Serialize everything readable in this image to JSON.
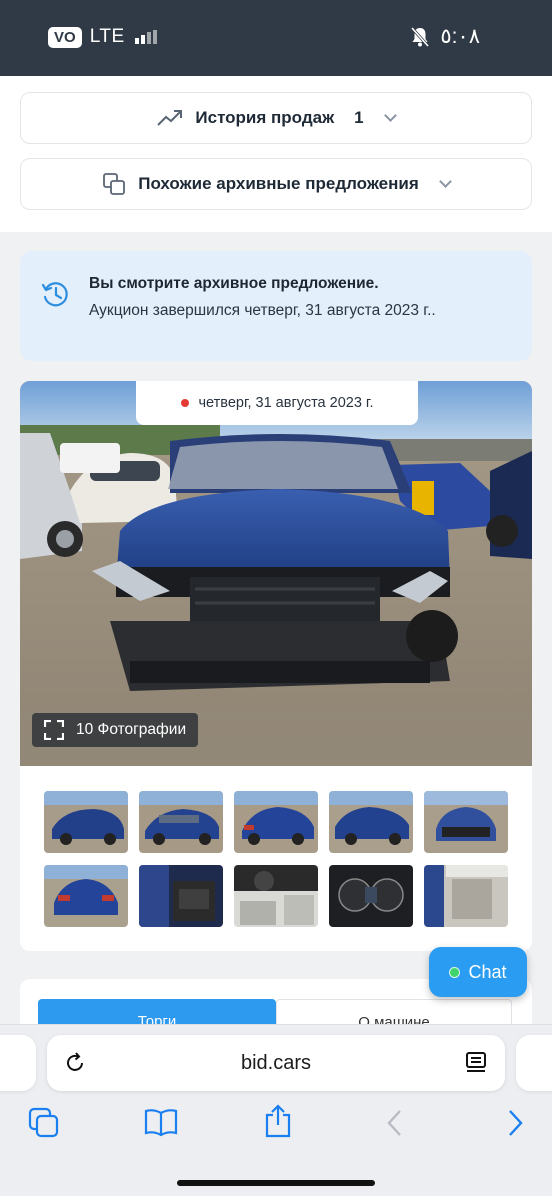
{
  "status_bar": {
    "vo_label": "VO",
    "network": "LTE",
    "time": "٥:٠٨"
  },
  "accordions": {
    "sales_history": {
      "label": "История продаж",
      "count": "1"
    },
    "similar_archived": {
      "label": "Похожие архивные предложения"
    }
  },
  "notice": {
    "title": "Вы смотрите архивное предложение.",
    "text": "Аукцион завершился четверг, 31 августа 2023 г.."
  },
  "gallery": {
    "date": "четверг, 31 августа 2023 г.",
    "photo_count_label": "10 Фотографии",
    "thumbnails": [
      {
        "label": "Передний ракурс слева"
      },
      {
        "label": "Боковой ракурс"
      },
      {
        "label": "Задний ракурс слева"
      },
      {
        "label": "Передний ракурс справа"
      },
      {
        "label": "Вид спереди"
      },
      {
        "label": "Вид сзади"
      },
      {
        "label": "Салон водителя"
      },
      {
        "label": "Приборная панель"
      },
      {
        "label": "Щиток приборов"
      },
      {
        "label": "Задние сиденья"
      }
    ]
  },
  "tabs": {
    "bidding": "Торги",
    "about_car": "О машине"
  },
  "chat": {
    "label": "Chat"
  },
  "browser": {
    "url": "bid.cars"
  },
  "colors": {
    "status_bar": "#2f3a46",
    "accent_blue": "#2d9af0",
    "notice_bg": "#e3effb",
    "car_blue": "#1f3d86",
    "online_green": "#3fd46b"
  }
}
